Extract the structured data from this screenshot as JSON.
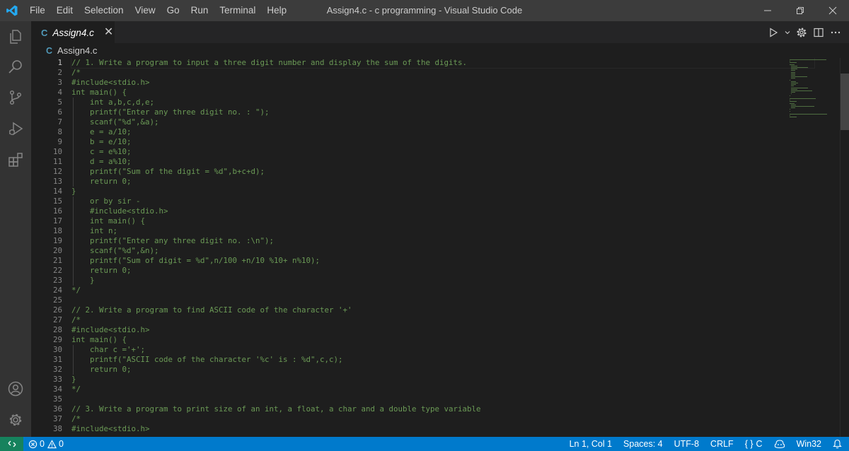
{
  "window": {
    "title": "Assign4.c - c programming - Visual Studio Code",
    "menu": [
      "File",
      "Edit",
      "Selection",
      "View",
      "Go",
      "Run",
      "Terminal",
      "Help"
    ]
  },
  "tab": {
    "lang_icon": "C",
    "label": "Assign4.c",
    "close": "✕"
  },
  "breadcrumb": {
    "lang_icon": "C",
    "file": "Assign4.c"
  },
  "editor": {
    "active_line": 1,
    "lines": [
      "// 1. Write a program to input a three digit number and display the sum of the digits.",
      "/*",
      "#include<stdio.h>",
      "int main() {",
      "    int a,b,c,d,e;",
      "    printf(\"Enter any three digit no. : \");",
      "    scanf(\"%d\",&a);",
      "    e = a/10;",
      "    b = e/10;",
      "    c = e%10;",
      "    d = a%10;",
      "    printf(\"Sum of the digit = %d\",b+c+d);",
      "    return 0;",
      "}",
      "    or by sir -",
      "    #include<stdio.h>",
      "    int main() {",
      "    int n;",
      "    printf(\"Enter any three digit no. :\\n\");",
      "    scanf(\"%d\",&n);",
      "    printf(\"Sum of digit = %d\",n/100 +n/10 %10+ n%10);",
      "    return 0;",
      "    }",
      "*/",
      "",
      "// 2. Write a program to find ASCII code of the character '+'",
      "/*",
      "#include<stdio.h>",
      "int main() {",
      "    char c ='+';",
      "    printf(\"ASCII code of the character '%c' is : %d\",c,c);",
      "    return 0;",
      "}",
      "*/",
      "",
      "// 3. Write a program to print size of an int, a float, a char and a double type variable",
      "/*",
      "#include<stdio.h>"
    ]
  },
  "statusbar": {
    "errors": "0",
    "warnings": "0",
    "position": "Ln 1, Col 1",
    "spaces": "Spaces: 4",
    "encoding": "UTF-8",
    "eol": "CRLF",
    "language": "C",
    "platform": "Win32"
  },
  "colors": {
    "comment": "#6a9955",
    "line_number": "#858585",
    "status_bar": "#007acc",
    "remote": "#16825d",
    "c_icon": "#519aba"
  },
  "icons": {
    "activity": [
      "explorer-icon",
      "search-icon",
      "source-control-icon",
      "run-debug-icon",
      "extensions-icon",
      "account-icon",
      "manage-gear-icon"
    ],
    "editor_actions": [
      "run-icon",
      "chevron-down-icon",
      "settings-gear-icon",
      "split-editor-icon",
      "more-icon"
    ]
  }
}
